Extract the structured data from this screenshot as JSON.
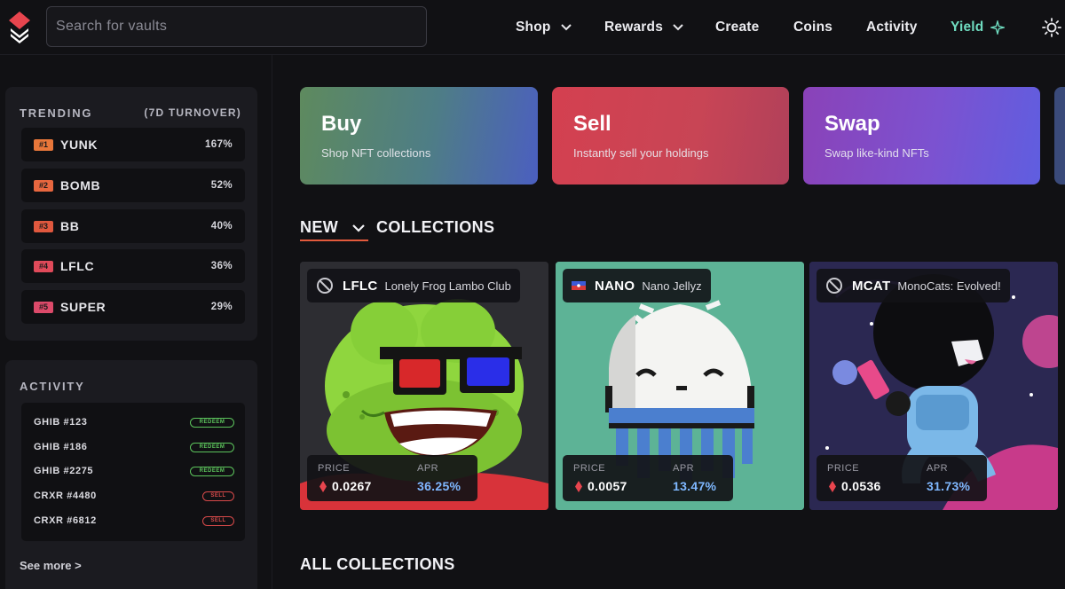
{
  "search": {
    "placeholder": "Search for vaults"
  },
  "nav": [
    {
      "label": "Shop",
      "has_dropdown": true
    },
    {
      "label": "Rewards",
      "has_dropdown": true
    },
    {
      "label": "Create"
    },
    {
      "label": "Coins"
    },
    {
      "label": "Activity"
    },
    {
      "label": "Yield",
      "icon": "sparkle-icon"
    }
  ],
  "header_icons": {
    "logo": "stacked-diamond-logo",
    "settings": "sun-icon"
  },
  "trending": {
    "title": "TRENDING",
    "subtitle": "(7D TURNOVER)",
    "items": [
      {
        "rank": "#1",
        "ticker": "YUNK",
        "pct": "167%",
        "color": "#e8773a"
      },
      {
        "rank": "#2",
        "ticker": "BOMB",
        "pct": "52%",
        "color": "#e8673f"
      },
      {
        "rank": "#3",
        "ticker": "BB",
        "pct": "40%",
        "color": "#e0583e"
      },
      {
        "rank": "#4",
        "ticker": "LFLC",
        "pct": "36%",
        "color": "#e04a5a"
      },
      {
        "rank": "#5",
        "ticker": "SUPER",
        "pct": "29%",
        "color": "#dc4a6a"
      }
    ]
  },
  "activity": {
    "title": "ACTIVITY",
    "items": [
      {
        "name": "GHIB #123",
        "badge": "REDEEM",
        "kind": "redeem"
      },
      {
        "name": "GHIB #186",
        "badge": "REDEEM",
        "kind": "redeem"
      },
      {
        "name": "GHIB #2275",
        "badge": "REDEEM",
        "kind": "redeem"
      },
      {
        "name": "CRXR #4480",
        "badge": "SELL",
        "kind": "sell"
      },
      {
        "name": "CRXR #6812",
        "badge": "SELL",
        "kind": "sell"
      }
    ],
    "see_more": "See more >"
  },
  "actions": [
    {
      "title": "Buy",
      "subtitle": "Shop NFT collections"
    },
    {
      "title": "Sell",
      "subtitle": "Instantly sell your holdings"
    },
    {
      "title": "Swap",
      "subtitle": "Swap like-kind NFTs"
    }
  ],
  "new_collections": {
    "filter_label": "NEW",
    "heading": "COLLECTIONS",
    "items": [
      {
        "ticker": "LFLC",
        "name": "Lonely Frog Lambo Club",
        "price_label": "PRICE",
        "price": "0.0267",
        "apr_label": "APR",
        "apr": "36.25%",
        "icon": "ban-icon"
      },
      {
        "ticker": "NANO",
        "name": "Nano Jellyz",
        "price_label": "PRICE",
        "price": "0.0057",
        "apr_label": "APR",
        "apr": "13.47%",
        "icon": "flag-icon"
      },
      {
        "ticker": "MCAT",
        "name": "MonoCats: Evolved!",
        "price_label": "PRICE",
        "price": "0.0536",
        "apr_label": "APR",
        "apr": "31.73%",
        "icon": "ban-icon"
      }
    ]
  },
  "all_collections": {
    "heading": "ALL COLLECTIONS"
  },
  "colors": {
    "accent": "#e25a3c",
    "yield": "#6fdcc0",
    "apr": "#7fb8ff",
    "redeem": "#5cc45c",
    "sell": "#d84a4a"
  }
}
